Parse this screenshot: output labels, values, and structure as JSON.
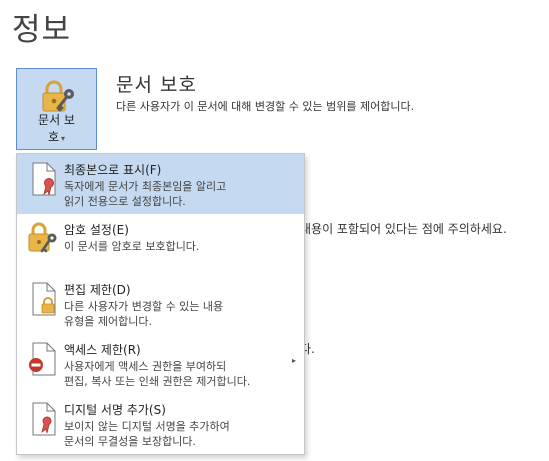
{
  "page": {
    "title": "정보"
  },
  "protect_button": {
    "label_line1": "문서 보",
    "label_line2": "호",
    "caret": "▾"
  },
  "section": {
    "title": "문서 보호",
    "description": "다른 사용자가 이 문서에 대해 변경할 수 있는 범위를 제어합니다."
  },
  "background_fragments": {
    "inspect_text": "내용이 포함되어 있다는 점에 주의하세요.",
    "period": "다."
  },
  "menu": {
    "items": [
      {
        "title": "최종본으로 표시(F)",
        "desc1": "독자에게 문서가 최종본임을 알리고",
        "desc2": "읽기 전용으로 설정합니다.",
        "icon": "final-document-icon",
        "active": true
      },
      {
        "title": "암호 설정(E)",
        "desc1": "이 문서를 암호로 보호합니다.",
        "desc2": "",
        "icon": "lock-key-icon",
        "active": false
      },
      {
        "title": "편집 제한(D)",
        "desc1": "다른 사용자가 변경할 수 있는 내용",
        "desc2": "유형을 제어합니다.",
        "icon": "restrict-editing-icon",
        "active": false
      },
      {
        "title": "액세스 제한(R)",
        "desc1": "사용자에게 액세스 권한을 부여하되",
        "desc2": "편집, 복사 또는 인쇄 권한은 제거합니다.",
        "icon": "restrict-access-icon",
        "active": false,
        "submenu_arrow": "▸"
      },
      {
        "title": "디지털 서명 추가(S)",
        "desc1": "보이지 않는 디지털 서명을 추가하여",
        "desc2": "문서의 무결성을 보장합니다.",
        "icon": "digital-signature-icon",
        "active": false
      }
    ]
  },
  "colors": {
    "active_bg": "#c5d9f1",
    "active_border": "#5b8fd0",
    "lock_gold": "#e8b54a",
    "ribbon_red": "#d9534f",
    "restrict_red": "#c0392b"
  }
}
